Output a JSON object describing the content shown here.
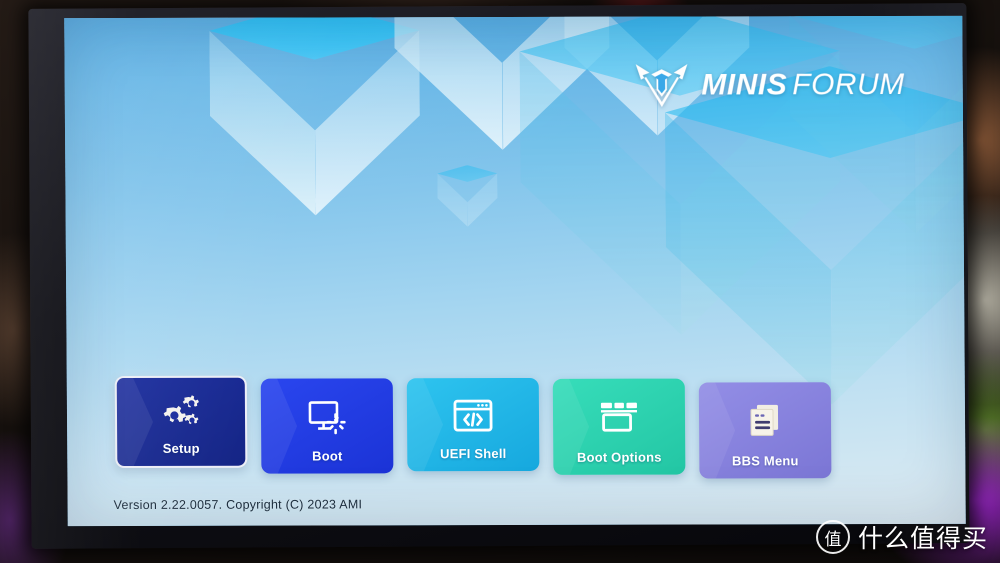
{
  "scene": {
    "description": "photo-of-monitor",
    "bezel_color": "#121218"
  },
  "screen": {
    "background_top_color": "#4ba6e0",
    "background_bottom_color": "#dce9f0"
  },
  "brand": {
    "logo_mark_name": "minisforum-shield-logo",
    "name_bold": "MINIS",
    "name_light": "FORUM"
  },
  "menu": {
    "tiles": [
      {
        "label": "Setup",
        "icon": "gears-icon",
        "color": "#1b2d9e",
        "color2": "#152585",
        "selected": true
      },
      {
        "label": "Boot",
        "icon": "monitor-spinner-icon",
        "color": "#2440e8",
        "color2": "#1b33d6",
        "selected": false
      },
      {
        "label": "UEFI Shell",
        "icon": "code-window-icon",
        "color": "#23bbeb",
        "color2": "#1aa9e0",
        "selected": false
      },
      {
        "label": "Boot Options",
        "icon": "window-list-icon",
        "color": "#2fd6b4",
        "color2": "#26c9a8",
        "selected": false
      },
      {
        "label": "BBS Menu",
        "icon": "documents-icon",
        "color": "#8b85e0",
        "color2": "#7d78d8",
        "selected": false
      }
    ]
  },
  "footer": {
    "version": "Version 2.22.0057. Copyright (C) 2023 AMI"
  },
  "watermark": {
    "badge": "值",
    "text": "什么值得买"
  }
}
